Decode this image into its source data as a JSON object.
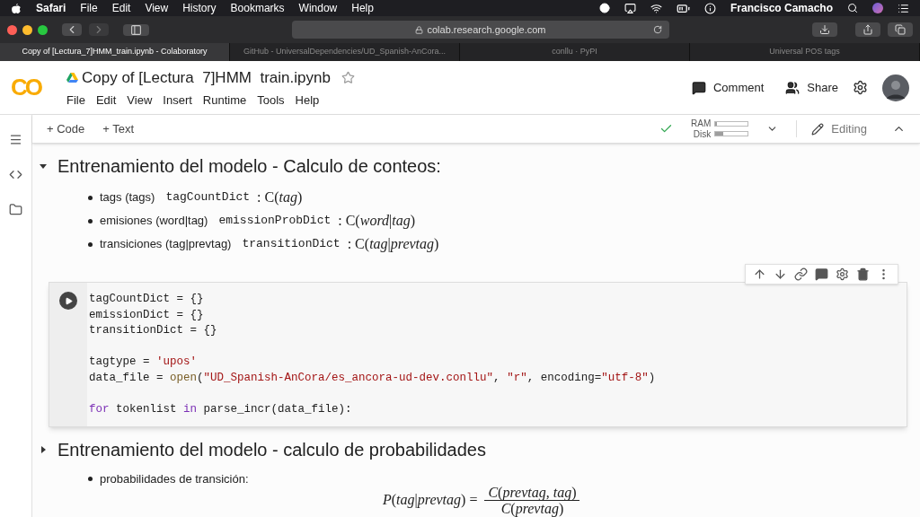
{
  "menubar": {
    "app": "Safari",
    "items": [
      "File",
      "Edit",
      "View",
      "History",
      "Bookmarks",
      "Window",
      "Help"
    ],
    "user": "Francisco Camacho"
  },
  "browser": {
    "url": "colab.research.google.com",
    "tabs": [
      {
        "label": "Copy of [Lectura_7]HMM_train.ipynb - Colaboratory",
        "selected": true
      },
      {
        "label": "GitHub - UniversalDependencies/UD_Spanish-AnCora...",
        "selected": false
      },
      {
        "label": "conllu · PyPI",
        "selected": false
      },
      {
        "label": "Universal POS tags",
        "selected": false
      }
    ]
  },
  "notebook": {
    "logo": "CO",
    "title": "Copy of [Lectura  7]HMM  train.ipynb",
    "starred": false,
    "menu": [
      "File",
      "Edit",
      "View",
      "Insert",
      "Runtime",
      "Tools",
      "Help"
    ],
    "comment": "Comment",
    "share": "Share"
  },
  "toolbar": {
    "add_code": "+ Code",
    "add_text": "+ Text",
    "ram": {
      "label": "RAM",
      "level": 0.05
    },
    "disk": {
      "label": "Disk",
      "level": 0.25
    },
    "connected": true,
    "mode": "Editing"
  },
  "sections": [
    {
      "heading": "Entrenamiento del modelo - Calculo de conteos:",
      "expanded": true,
      "bullets": [
        {
          "text": "tags (tags)",
          "code": "tagCountDict",
          "math": ": C(*tag*)"
        },
        {
          "text": "emisiones (word|tag)",
          "code": "emissionProbDict",
          "math": ": C(*word*|*tag*)"
        },
        {
          "text": "transiciones (tag|prevtag)",
          "code": "transitionDict",
          "math": ": C(*tag*|*prevtag*)"
        }
      ],
      "cell": {
        "lines": [
          {
            "space_before": false,
            "tokens": [
              {
                "kind": "plain",
                "text": "tagCountDict = {}"
              }
            ]
          },
          {
            "space_before": false,
            "tokens": [
              {
                "kind": "plain",
                "text": "emissionDict = {}"
              }
            ]
          },
          {
            "space_before": false,
            "tokens": [
              {
                "kind": "plain",
                "text": "transitionDict = {}"
              }
            ]
          },
          {
            "space_before": true,
            "tokens": [
              {
                "kind": "plain",
                "text": "tagtype = "
              },
              {
                "kind": "string",
                "text": "'upos'"
              }
            ]
          },
          {
            "space_before": false,
            "tokens": [
              {
                "kind": "plain",
                "text": "data_file = "
              },
              {
                "kind": "builtin",
                "text": "open"
              },
              {
                "kind": "plain",
                "text": "("
              },
              {
                "kind": "string",
                "text": "\"UD_Spanish-AnCora/es_ancora-ud-dev.conllu\""
              },
              {
                "kind": "plain",
                "text": ", "
              },
              {
                "kind": "string",
                "text": "\"r\""
              },
              {
                "kind": "plain",
                "text": ", encoding="
              },
              {
                "kind": "string",
                "text": "\"utf-8\""
              },
              {
                "kind": "plain",
                "text": ")"
              }
            ]
          },
          {
            "space_before": true,
            "tokens": [
              {
                "kind": "keyword",
                "text": "for"
              },
              {
                "kind": "plain",
                "text": " tokenlist "
              },
              {
                "kind": "keyword",
                "text": "in"
              },
              {
                "kind": "plain",
                "text": " parse_incr(data_file):"
              }
            ]
          }
        ]
      }
    },
    {
      "heading": "Entrenamiento del modelo - calculo de probabilidades",
      "expanded": false,
      "bullets": [
        {
          "text": "probabilidades de transición:"
        }
      ],
      "formula": {
        "lhs": "*P*(*tag*|*prevtag*) =",
        "numerator": "*C*(*prevtag*, *tag*)",
        "denominator": "*C*(*prevtag*)"
      }
    }
  ]
}
